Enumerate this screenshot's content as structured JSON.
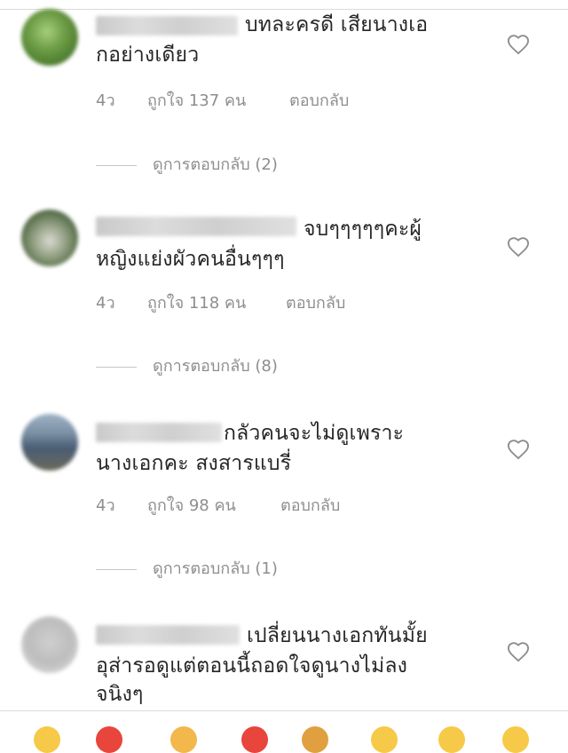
{
  "comments": [
    {
      "text_line1": "บทละครดี เสียนางเอ",
      "text_line2": "กอย่างเดียว",
      "time": "4ว",
      "likes": "ถูกใจ 137 คน",
      "reply": "ตอบกลับ",
      "view_replies": "ดูการตอบกลับ (2)"
    },
    {
      "text_line1": "จบๆๆๆๆๆคะผู้",
      "text_line2": "หญิงแย่งผัวคนอื่นๆๆๆ",
      "time": "4ว",
      "likes": "ถูกใจ 118 คน",
      "reply": "ตอบกลับ",
      "view_replies": "ดูการตอบกลับ (8)"
    },
    {
      "text_line1": "กลัวคนจะไม่ดูเพราะ",
      "text_line2": "นางเอกคะ สงสารแบรี่",
      "time": "4ว",
      "likes": "ถูกใจ 98 คน",
      "reply": "ตอบกลับ",
      "view_replies": "ดูการตอบกลับ (1)"
    },
    {
      "text_line1": "เปลี่ยนนางเอกทันมั้ย",
      "text_line2": "อุส่ารอดูแต่ตอนนี้ถอดใจดูนางไม่ลง",
      "text_line3": "จนิงๆ"
    }
  ],
  "icons": {
    "like": "heart-outline-icon"
  },
  "colors": {
    "text": "#262626",
    "meta": "#8e8e8e",
    "divider": "#dbdbdb"
  }
}
